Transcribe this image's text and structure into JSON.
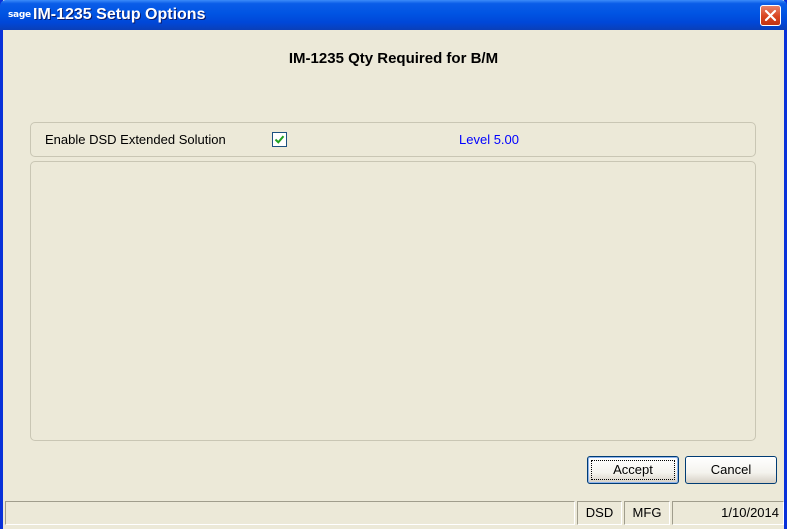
{
  "window": {
    "title": "IM-1235 Setup Options",
    "app_icon_text": "sage"
  },
  "header": {
    "title": "IM-1235  Qty Required for B/M"
  },
  "options": {
    "enable_label": "Enable DSD Extended Solution",
    "enable_checked": true,
    "level_text": "Level  5.00"
  },
  "buttons": {
    "accept_prefix": "A",
    "accept_rest": "ccept",
    "cancel_prefix": "C",
    "cancel_rest": "ancel"
  },
  "statusbar": {
    "main": "",
    "module1": "DSD",
    "module2": "MFG",
    "date": "1/10/2014"
  },
  "colors": {
    "titlebar": "#0054E3",
    "window_bg": "#ECE9D8",
    "level_text": "#0000FF",
    "close_button": "#D9451F"
  }
}
